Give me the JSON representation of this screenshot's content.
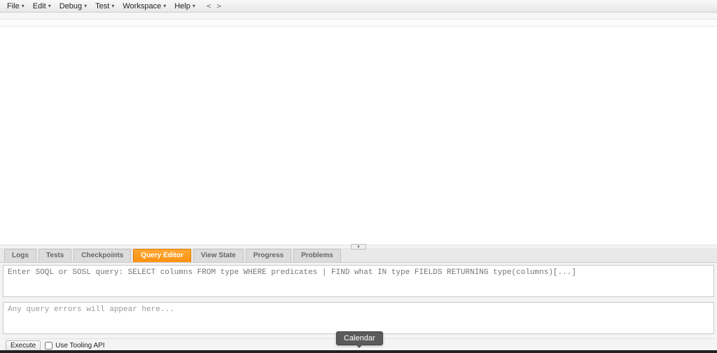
{
  "menubar": {
    "items": [
      {
        "label": "File"
      },
      {
        "label": "Edit"
      },
      {
        "label": "Debug"
      },
      {
        "label": "Test"
      },
      {
        "label": "Workspace"
      },
      {
        "label": "Help"
      }
    ],
    "nav_prev": "<",
    "nav_next": ">"
  },
  "bottom_tabs": [
    {
      "label": "Logs",
      "active": false
    },
    {
      "label": "Tests",
      "active": false
    },
    {
      "label": "Checkpoints",
      "active": false
    },
    {
      "label": "Query Editor",
      "active": true
    },
    {
      "label": "View State",
      "active": false
    },
    {
      "label": "Progress",
      "active": false
    },
    {
      "label": "Problems",
      "active": false
    }
  ],
  "query_editor": {
    "placeholder": "Enter SOQL or SOSL query: SELECT columns FROM type WHERE predicates | FIND what IN type FIELDS RETURNING type(columns)[...]",
    "value": "",
    "errors_placeholder": "Any query errors will appear here...",
    "execute_label": "Execute",
    "tooling_api_label": "Use Tooling API",
    "tooling_api_checked": false
  },
  "tooltip": {
    "text": "Calendar"
  }
}
